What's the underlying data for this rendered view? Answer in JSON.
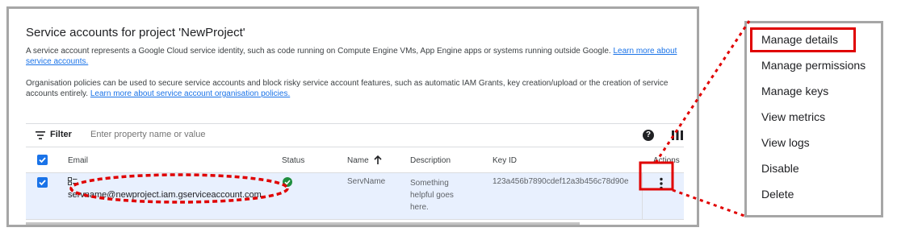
{
  "page": {
    "title": "Service accounts for project 'NewProject'",
    "intro": "A service account represents a Google Cloud service identity, such as code running on Compute Engine VMs, App Engine apps or systems running outside Google.",
    "intro_link": "Learn more about service accounts.",
    "org_text": "Organisation policies can be used to secure service accounts and block risky service account features, such as automatic IAM Grants, key creation/upload or the creation of service accounts entirely.",
    "org_link": "Learn more about service account organisation policies."
  },
  "filter": {
    "label": "Filter",
    "placeholder": "Enter property name or value",
    "icon": "filter-icon",
    "help_icon": "help-icon",
    "columns_icon": "column-display-icon"
  },
  "table": {
    "columns": {
      "email": "Email",
      "status": "Status",
      "name": "Name",
      "description": "Description",
      "key_id": "Key ID",
      "actions": "Actions"
    },
    "sort_icon": "arrow-up-icon",
    "rows": [
      {
        "checked": true,
        "email": "servname@newproject.iam.gserviceaccount.com",
        "status_icon": "check-circle-icon",
        "name": "ServName",
        "description": "Something helpful goes here.",
        "key_id": "123a456b7890cdef12a3b456c78d90e",
        "actions_icon": "more-vert-icon"
      }
    ]
  },
  "menu": {
    "items": [
      "Manage details",
      "Manage permissions",
      "Manage keys",
      "View metrics",
      "View logs",
      "Disable",
      "Delete"
    ],
    "highlighted": "Manage details"
  },
  "colors": {
    "accent": "#1a73e8",
    "status_ok": "#1e8e3e",
    "annotation": "#e00000",
    "selected_row": "#e8f0fe"
  }
}
